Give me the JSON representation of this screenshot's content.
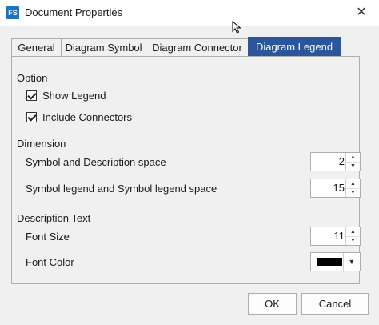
{
  "window": {
    "app_icon_text": "FS",
    "title": "Document Properties",
    "close_glyph": "✕"
  },
  "tabs": [
    {
      "label": "General",
      "active": false
    },
    {
      "label": "Diagram Symbol",
      "active": false
    },
    {
      "label": "Diagram Connector",
      "active": false
    },
    {
      "label": "Diagram Legend",
      "active": true
    }
  ],
  "option": {
    "heading": "Option",
    "show_legend": {
      "label": "Show Legend",
      "checked": true
    },
    "include_connectors": {
      "label": "Include Connectors",
      "checked": true
    }
  },
  "dimension": {
    "heading": "Dimension",
    "symbol_description_space": {
      "label": "Symbol and Description space",
      "value": "2"
    },
    "symbol_legend_space": {
      "label": "Symbol legend and Symbol legend space",
      "value": "15"
    }
  },
  "description_text": {
    "heading": "Description Text",
    "font_size": {
      "label": "Font Size",
      "value": "11"
    },
    "font_color": {
      "label": "Font Color",
      "color": "#000000"
    }
  },
  "buttons": {
    "ok": "OK",
    "cancel": "Cancel"
  },
  "colors": {
    "active_tab": "#2b579a",
    "background": "#f0f0f0"
  }
}
